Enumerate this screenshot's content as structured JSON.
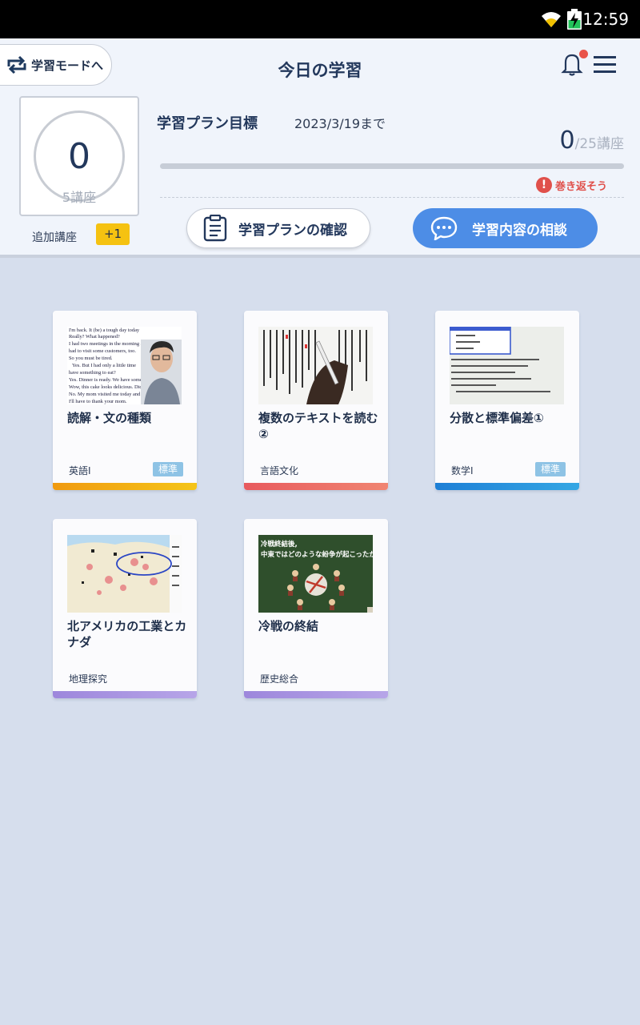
{
  "status_bar": {
    "time": "12:59"
  },
  "header": {
    "mode_button": "学習モードへ",
    "title": "今日の学習"
  },
  "summary": {
    "count": "0",
    "count_unit": "5講座",
    "added_label": "追加講座",
    "added_badge": "+1"
  },
  "plan": {
    "label": "学習プラン目標",
    "date": "2023/3/19まで",
    "done": "0",
    "total": "/25講座",
    "progress": 0,
    "warning": "巻き返そう",
    "confirm_button": "学習プランの確認",
    "consult_button": "学習内容の相談"
  },
  "lessons": [
    {
      "title": "読解・文の種類",
      "subject": "英語Ⅰ",
      "level": "標準",
      "color": "#f0a511"
    },
    {
      "title": "複数のテキストを読む②",
      "subject": "言語文化",
      "level": "",
      "color": "#ea6b68"
    },
    {
      "title": "分散と標準偏差①",
      "subject": "数学Ⅰ",
      "level": "標準",
      "color": "#2c8fd9"
    },
    {
      "title": "北アメリカの工業とカナダ",
      "subject": "地理探究",
      "level": "",
      "color": "#a995e0"
    },
    {
      "title": "冷戦の終結",
      "subject": "歴史総合",
      "level": "",
      "color": "#a995e0"
    }
  ],
  "thumbnails": {
    "english": {
      "lines": [
        "I'm back. It (be) a tough day today",
        "Really? What happened?",
        "I had two meetings in the morning and",
        "had to visit some customers, too.",
        "So you must be tired.",
        "Yes. But I had only a little time",
        "have something to eat?",
        "Yes. Dinner is ready. We have some dessert,",
        "Wow, this cake looks delicious. Did you",
        "No. My mom visited me today and",
        "I'll have to thank your mom."
      ]
    },
    "history": {
      "caption_1": "冷戦終結後,",
      "caption_2": "中東ではどのような紛争が起こったか"
    }
  }
}
